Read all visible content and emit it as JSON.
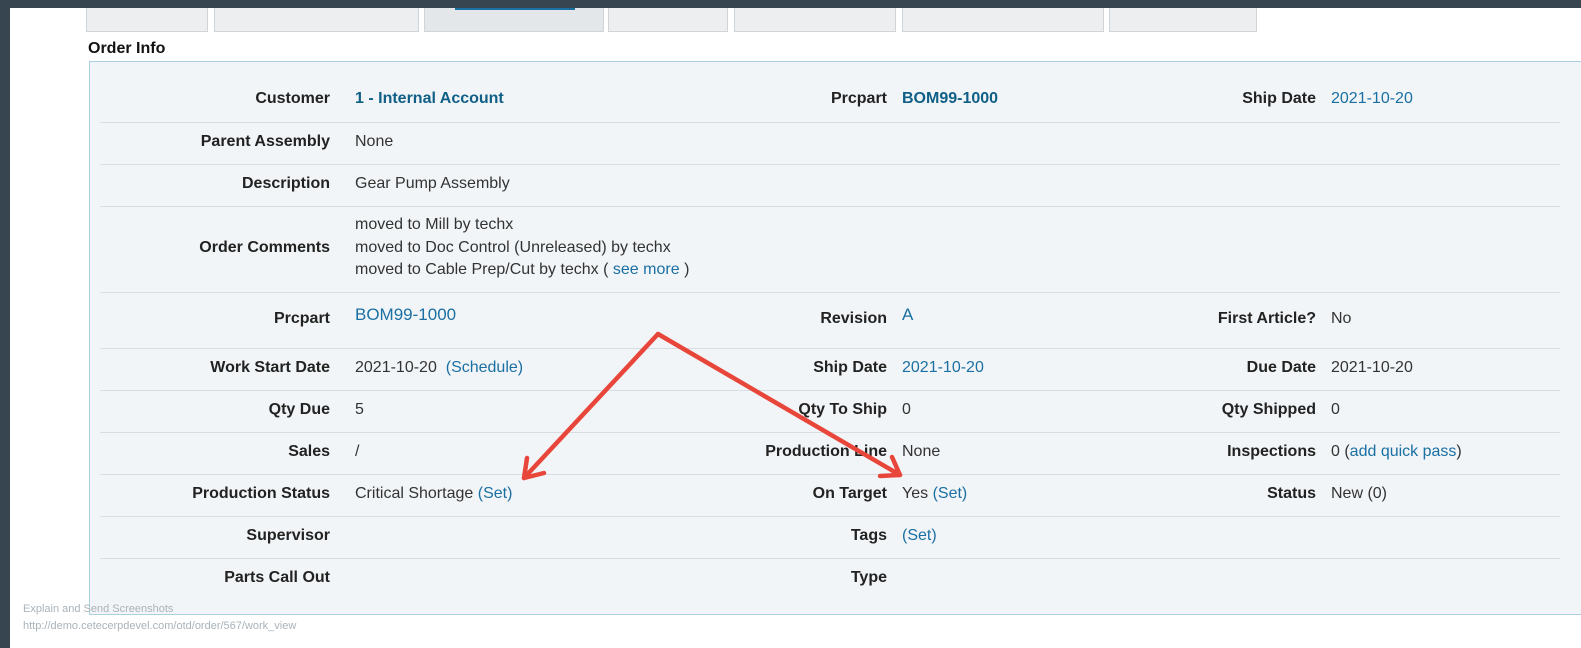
{
  "section_title": "Order Info",
  "rows": {
    "customer": {
      "label": "Customer",
      "value": "1 - Internal Account",
      "prcpart_label": "Prcpart",
      "prcpart_value": "BOM99-1000",
      "ship_label": "Ship Date",
      "ship_value": "2021-10-20"
    },
    "parent": {
      "label": "Parent Assembly",
      "value": "None"
    },
    "description": {
      "label": "Description",
      "value": "Gear Pump Assembly"
    },
    "comments": {
      "label": "Order Comments",
      "line1": "moved to Mill by techx",
      "line2": "moved to Doc Control (Unreleased) by techx",
      "line3": "moved to Cable Prep/Cut by techx (",
      "see_more": "see more",
      "close": ")"
    },
    "prcpart": {
      "label": "Prcpart",
      "value": "BOM99-1000",
      "revision_label": "Revision",
      "revision_value": "A",
      "first_article_label": "First Article?",
      "first_article_value": "No"
    },
    "work_start": {
      "label": "Work Start Date",
      "value": "2021-10-20",
      "schedule_link": "(Schedule)",
      "ship_label": "Ship Date",
      "ship_value": "2021-10-20",
      "due_label": "Due Date",
      "due_value": "2021-10-20"
    },
    "qty": {
      "label": "Qty Due",
      "value": "5",
      "to_ship_label": "Qty To Ship",
      "to_ship_value": "0",
      "shipped_label": "Qty Shipped",
      "shipped_value": "0"
    },
    "sales": {
      "label": "Sales",
      "value": "/",
      "line_label": "Production Line",
      "line_value": "None",
      "inspections_label": "Inspections",
      "inspections_prefix": "0 (",
      "inspections_link": "add quick pass",
      "inspections_suffix": ")"
    },
    "prod_status": {
      "label": "Production Status",
      "value": "Critical Shortage",
      "set_link": "(Set)",
      "on_target_label": "On Target",
      "on_target_value": "Yes",
      "on_target_set": "(Set)",
      "status_label": "Status",
      "status_value": "New (0)"
    },
    "supervisor": {
      "label": "Supervisor",
      "tags_label": "Tags",
      "tags_set": "(Set)"
    },
    "parts_call": {
      "label": "Parts Call Out",
      "type_label": "Type"
    }
  },
  "footer": {
    "line1": "Explain and Send Screenshots",
    "line2": "http://demo.cetecerpdevel.com/otd/order/567/work_view"
  },
  "colors": {
    "annotation_arrow": "#e8463a",
    "link": "#1a6fa3",
    "background": "#36454f"
  }
}
